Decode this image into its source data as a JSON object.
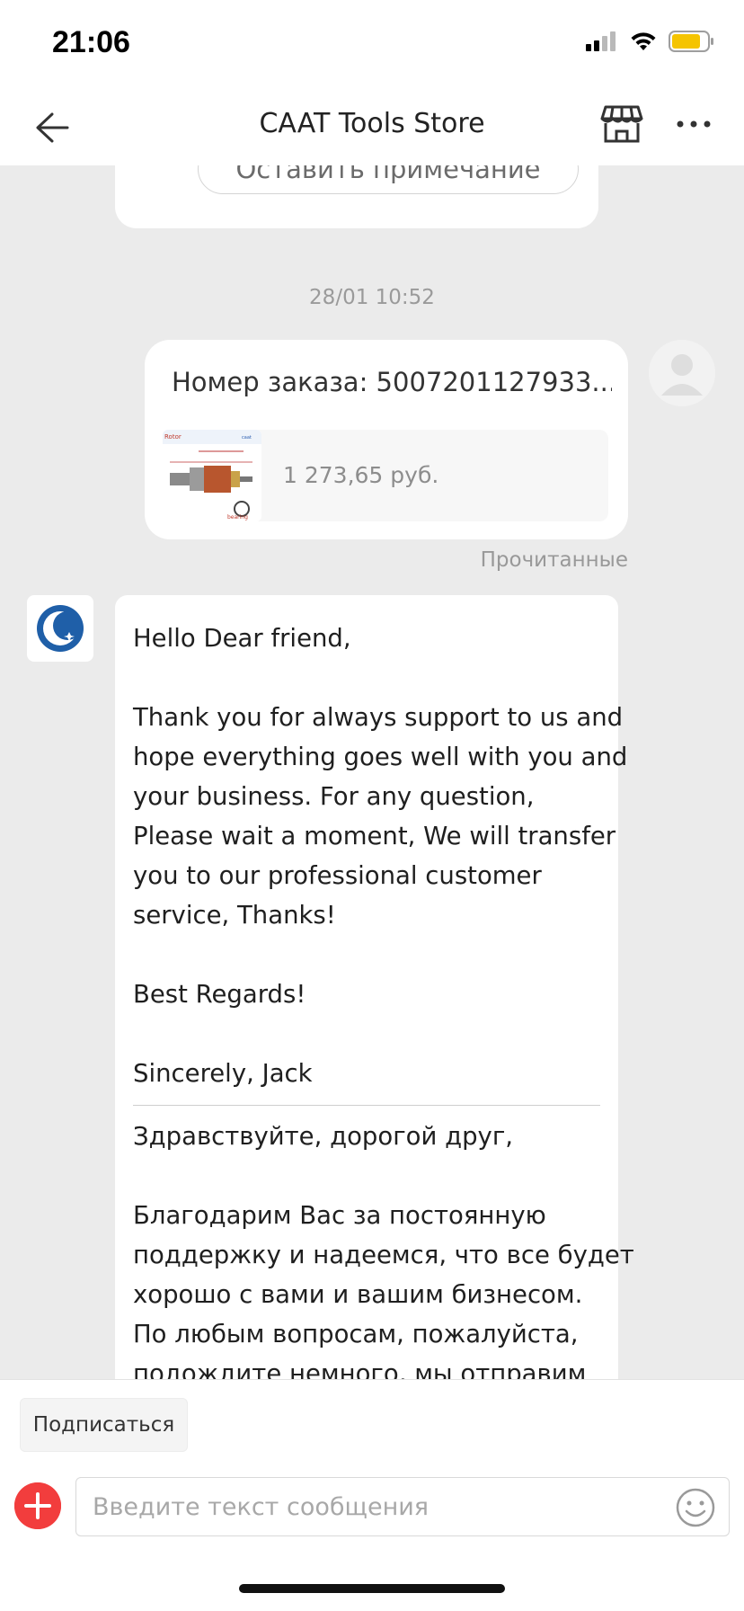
{
  "status_bar": {
    "time": "21:06",
    "battery_color": "#f5c400"
  },
  "header": {
    "title": "CAAT Tools Store",
    "back_icon": "arrow-left-icon",
    "store_icon": "storefront-icon",
    "more_icon": "more-dots-icon"
  },
  "previous_card": {
    "note_button_label": "Оставить примечание"
  },
  "messages": {
    "timestamp": "28/01 10:52",
    "order": {
      "order_number_label": "Номер заказа: 5007201127933...",
      "product_price": "1 273,65 руб.",
      "read_status": "Прочитанные"
    },
    "store_message": {
      "lines": [
        "Hello Dear friend,",
        "",
        "Thank you for always support to us and",
        "hope everything goes well with you and",
        "your business.  For any question,",
        "Please wait a moment, We will transfer",
        "you to our professional customer",
        "service, Thanks!",
        "",
        "Best Regards!",
        "",
        "Sincerely, Jack"
      ],
      "lines_ru": [
        "Здравствуйте, дорогой друг,",
        "",
        "Благодарим Вас за постоянную",
        "поддержку и надеемся, что все будет",
        "хорошо с вами и вашим бизнесом.",
        "По любым вопросам, пожалуйста,",
        "подождите немного, мы отправим"
      ]
    }
  },
  "bottom_bar": {
    "subscribe_label": "Подписаться",
    "input_placeholder": "Введите текст сообщения",
    "add_icon": "plus-circle-icon",
    "emoji_icon": "smiley-icon",
    "accent_color": "#f23d3d"
  }
}
